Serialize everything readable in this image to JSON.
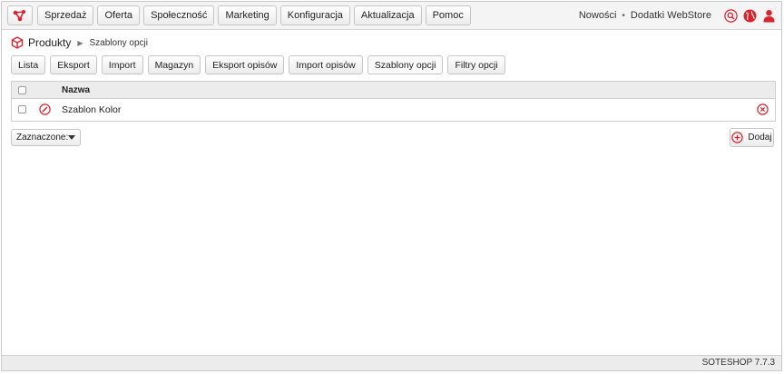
{
  "menu": {
    "items": [
      "Sprzedaż",
      "Oferta",
      "Społeczność",
      "Marketing",
      "Konfiguracja",
      "Aktualizacja",
      "Pomoc"
    ]
  },
  "top_right": {
    "news": "Nowości",
    "separator": "•",
    "addons": "Dodatki WebStore"
  },
  "breadcrumb": {
    "title": "Produkty",
    "current": "Szablony opcji"
  },
  "tabs": [
    "Lista",
    "Eksport",
    "Import",
    "Magazyn",
    "Eksport opisów",
    "Import opisów",
    "Szablony opcji",
    "Filtry opcji"
  ],
  "active_tab": "Szablony opcji",
  "grid": {
    "columns": [
      "Nazwa"
    ],
    "rows": [
      {
        "name": "Szablon Kolor"
      }
    ]
  },
  "actions": {
    "selected_label": "Zaznaczone:",
    "add_label": "Dodaj"
  },
  "footer": {
    "version": "SOTESHOP 7.7.3"
  },
  "colors": {
    "accent": "#d9232d"
  }
}
